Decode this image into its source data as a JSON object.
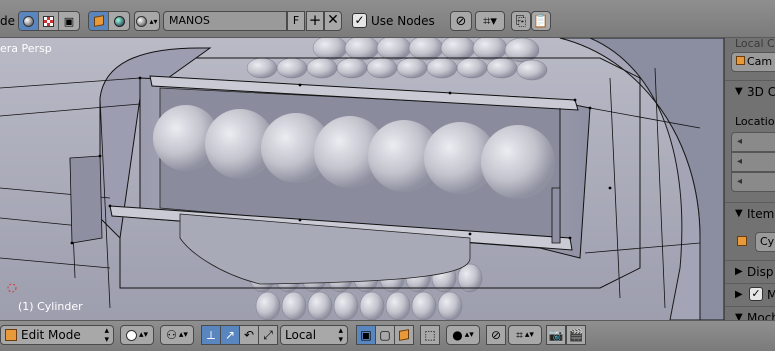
{
  "top_header": {
    "mode_stub": "de",
    "material_name": "MANOS",
    "fake_user_label": "F",
    "add_label": "+",
    "unlink_label": "✕",
    "use_nodes_checked": "✓",
    "use_nodes_label": "Use Nodes"
  },
  "viewport": {
    "view_title": "era Persp",
    "object_label": "(1) Cylinder"
  },
  "properties_panel": {
    "local_camera_label": "Local Ca",
    "camera_field": "Cam",
    "cursor_section": "3D C",
    "location_label": "Location",
    "item_section": "Item",
    "object_name": "Cy",
    "display_section": "Disp",
    "matcap_section": "M",
    "motion_section": "Moch"
  },
  "bottom_header": {
    "mode": "Edit Mode",
    "orientation": "Local"
  },
  "colors": {
    "header_bg": "#858585",
    "viewport_bg": "#6f6f6f",
    "mesh_surface": "#a7a8b8",
    "selected_blue": "#5a86c0"
  }
}
